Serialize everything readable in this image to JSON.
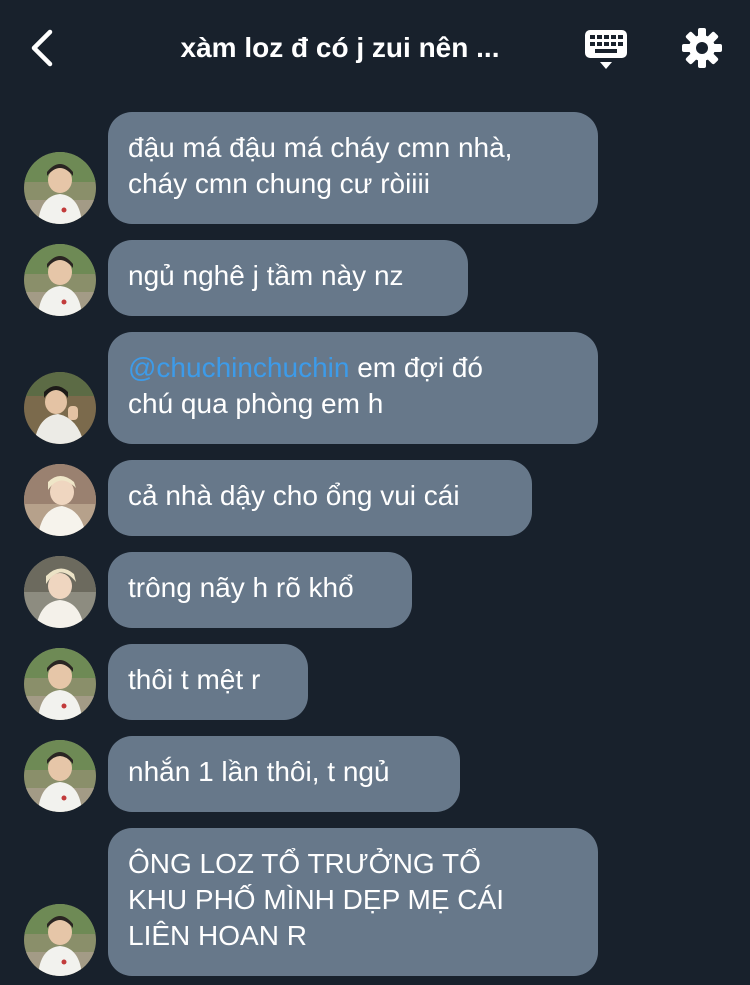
{
  "header": {
    "title": "xàm loz đ có j zui nên ...",
    "back_icon": "chevron-left-icon",
    "keyboard_icon": "keyboard-icon",
    "settings_icon": "gear-icon"
  },
  "colors": {
    "background": "#18212c",
    "bubble": "#67788a",
    "mention": "#3d9be9",
    "text": "#ffffff"
  },
  "messages": [
    {
      "text": "đậu má đậu má cháy cmn nhà,\ncháy cmn chung cư ròiiii"
    },
    {
      "text": "ngủ nghê j tầm này nz"
    },
    {
      "mention": "@chuchinchuchin",
      "text": " em đợi đó\nchú qua phòng em h"
    },
    {
      "text": "cả nhà dậy cho ổng vui cái"
    },
    {
      "text": "trông nãy h rõ khổ"
    },
    {
      "text": "thôi t mệt r"
    },
    {
      "text": "nhắn 1 lần thôi, t ngủ"
    },
    {
      "text": "ÔNG LOZ TỔ TRƯỞNG TỔ\nKHU PHỐ MÌNH DẸP MẸ CÁI\nLIÊN HOAN R"
    }
  ]
}
